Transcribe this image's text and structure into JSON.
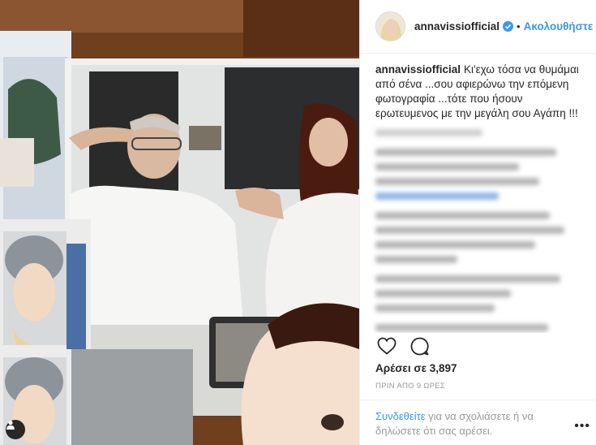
{
  "post": {
    "username": "annavissiofficial",
    "follow_label": "Ακολουθήστε",
    "dot": "•",
    "caption": "Κι'εχω τόσα να θυμάμαι από σένα ...σου αφιερώνω την επόμενη φωτογραφία ...τότε που ήσουν ερωτευμενος με την μεγάλη σου Αγάπη !!!",
    "likes": "Αρέσει σε 3,897",
    "time": "ΠΡΙΝ ΑΠΟ 9 ΩΡΕΣ",
    "footer_login": "Συνδεθείτε",
    "footer_text": " για να σχολιάσετε ή να δηλώσετε ότι σας αρέσει.",
    "more": "•••"
  },
  "icons": {
    "verified": "verified-badge-icon",
    "like": "heart-icon",
    "comment": "comment-bubble-icon",
    "tag": "person-tag-icon"
  },
  "colors": {
    "link": "#3897f0",
    "text": "#262626",
    "muted": "#999999"
  }
}
